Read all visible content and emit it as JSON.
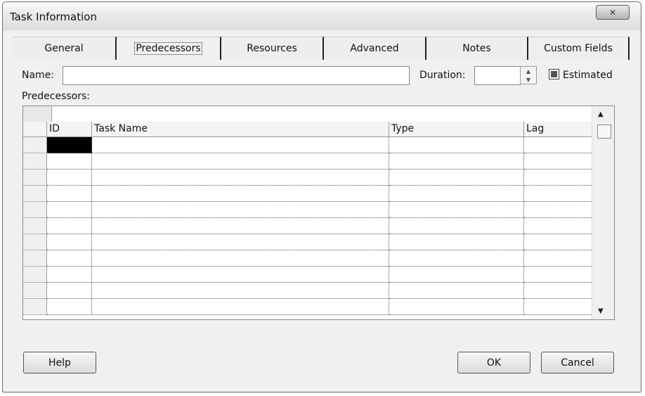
{
  "window": {
    "title": "Task Information",
    "close_glyph": "✕"
  },
  "tabs": [
    {
      "label": "General"
    },
    {
      "label": "Predecessors"
    },
    {
      "label": "Resources"
    },
    {
      "label": "Advanced"
    },
    {
      "label": "Notes"
    },
    {
      "label": "Custom Fields"
    }
  ],
  "form": {
    "name_label": "Name:",
    "name_value": "",
    "duration_label": "Duration:",
    "duration_value": "",
    "estimated_label": "Estimated",
    "estimated_checked": true,
    "predecessors_label": "Predecessors:"
  },
  "grid": {
    "columns": [
      "ID",
      "Task Name",
      "Type",
      "Lag"
    ],
    "rows": 11
  },
  "buttons": {
    "help": "Help",
    "ok": "OK",
    "cancel": "Cancel"
  },
  "icons": {
    "close": "close-icon",
    "spin_up": "up-arrow-icon",
    "spin_down": "down-arrow-icon",
    "scroll_up": "scroll-up-icon",
    "scroll_down": "scroll-down-icon"
  }
}
